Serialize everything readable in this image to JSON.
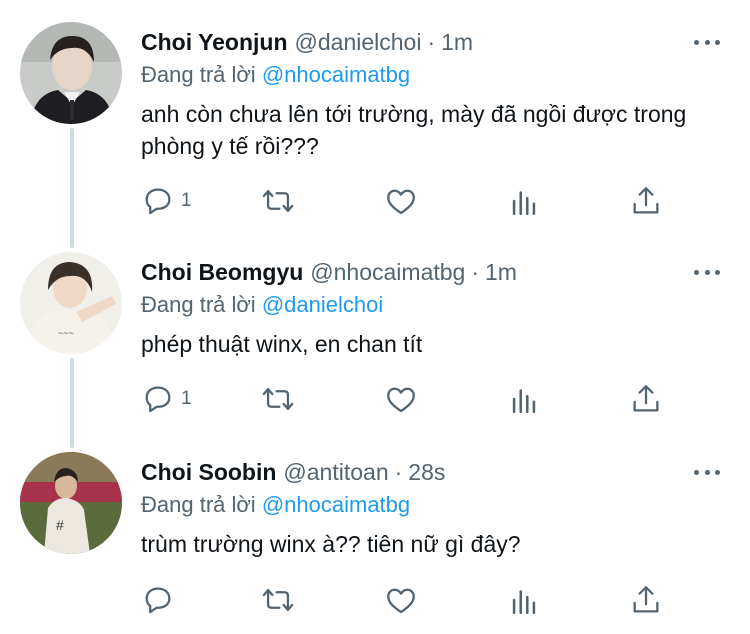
{
  "tweets": [
    {
      "name": "Choi Yeonjun",
      "handle": "@danielchoi",
      "dot": "·",
      "time": "1m",
      "reply_prefix": "Đang trả lời",
      "reply_to": "@nhocaimatbg",
      "text": "anh còn chưa lên tới trường, mày đã ngồi được trong phòng y tế rồi???",
      "reply_count": "1",
      "icons": [
        "reply-icon",
        "retweet-icon",
        "like-icon",
        "analytics-icon",
        "share-icon"
      ]
    },
    {
      "name": "Choi Beomgyu",
      "handle": "@nhocaimatbg",
      "dot": "·",
      "time": "1m",
      "reply_prefix": "Đang trả lời",
      "reply_to": "@danielchoi",
      "text": "phép thuật winx, en chan tít",
      "reply_count": "1",
      "icons": [
        "reply-icon",
        "retweet-icon",
        "like-icon",
        "analytics-icon",
        "share-icon"
      ]
    },
    {
      "name": "Choi Soobin",
      "handle": "@antitoan",
      "dot": "·",
      "time": "28s",
      "reply_prefix": "Đang trả lời",
      "reply_to": "@nhocaimatbg",
      "text": "trùm trường winx à?? tiên nữ gì đây?",
      "reply_count": "",
      "icons": [
        "reply-icon",
        "retweet-icon",
        "like-icon",
        "analytics-icon",
        "share-icon"
      ]
    }
  ],
  "colors": {
    "text": "#0f1419",
    "secondary": "#536471",
    "link": "#1d9bf0",
    "thread_line": "#cfd9de"
  }
}
